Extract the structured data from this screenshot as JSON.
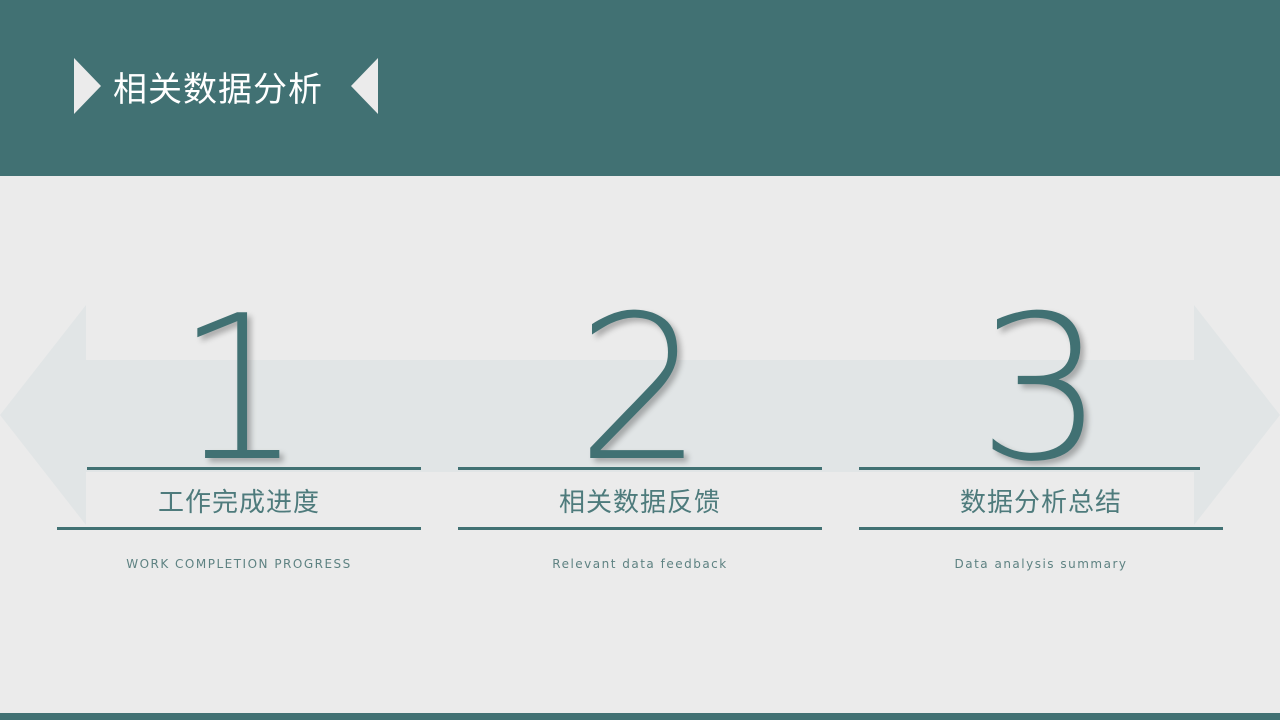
{
  "header": {
    "title": "相关数据分析"
  },
  "steps": [
    {
      "number": "1",
      "title": "工作完成进度",
      "subtitle": "WORK COMPLETION PROGRESS"
    },
    {
      "number": "2",
      "title": "相关数据反馈",
      "subtitle": "Relevant data feedback"
    },
    {
      "number": "3",
      "title": "数据分析总结",
      "subtitle": "Data analysis summary"
    }
  ],
  "colors": {
    "accent": "#417173",
    "background": "#ebebeb",
    "arrow_fill": "#e1e5e6"
  }
}
